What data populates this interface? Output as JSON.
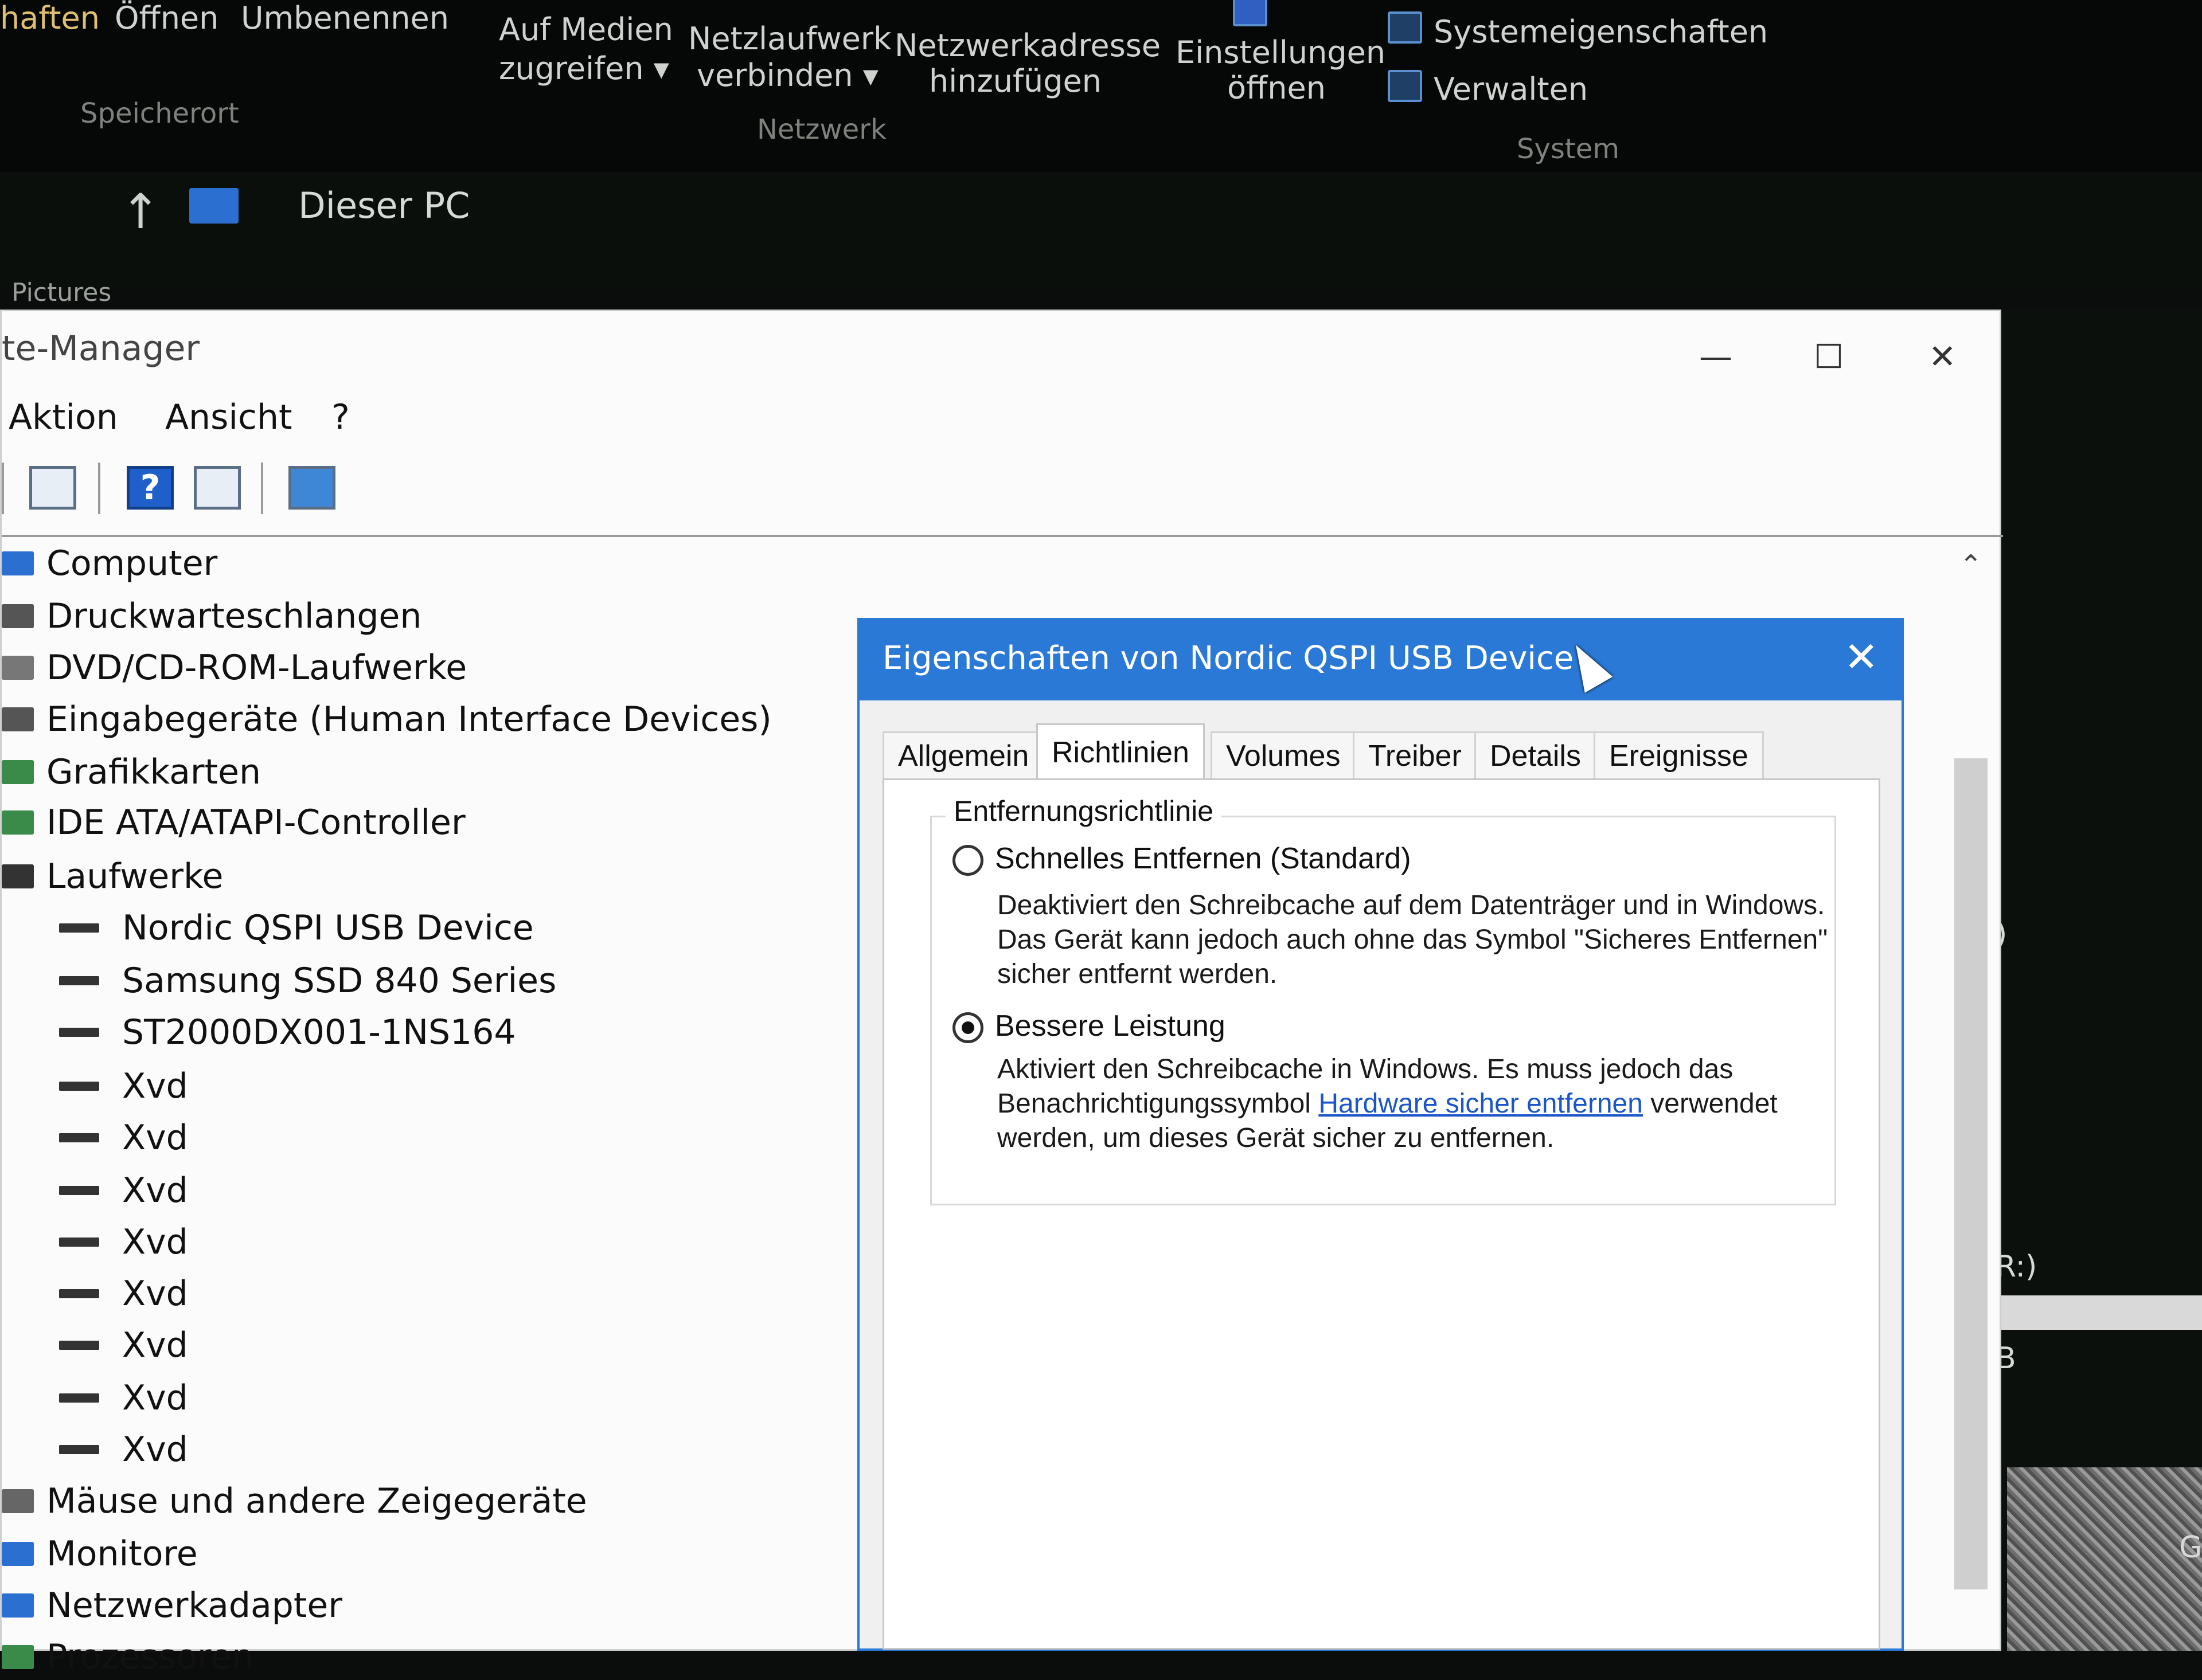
{
  "explorer": {
    "ribbon": {
      "left_items": [
        "haften",
        "Öffnen",
        "Umbenennen"
      ],
      "speicherort_label": "Speicherort",
      "media_btn": [
        "Auf Medien",
        "zugreifen ▾"
      ],
      "netdrive_btn": [
        "Netzlaufwerk",
        "verbinden ▾"
      ],
      "netaddr_btn": [
        "Netzwerkadresse",
        "hinzufügen"
      ],
      "netzwerk_label": "Netzwerk",
      "settings_btn": [
        "Einstellungen",
        "öffnen"
      ],
      "sys_props": "Systemeigenschaften",
      "manage": "Verwalten",
      "system_label": "System"
    },
    "address": {
      "path": "Dieser PC",
      "ghost_text": "Pictures"
    },
    "right_strip": {
      "text1": ")",
      "text2": "R:)",
      "text3": "B",
      "text4": "G"
    }
  },
  "device_manager": {
    "title": "te-Manager",
    "window_buttons": {
      "min": "—",
      "max": "☐",
      "close": "✕"
    },
    "menu": [
      "Aktion",
      "Ansicht",
      "?"
    ],
    "tree": [
      {
        "label": "Computer",
        "icon": "computer-icon",
        "level": 0,
        "color": "#2b6fd0"
      },
      {
        "label": "Druckwarteschlangen",
        "icon": "printer-icon",
        "level": 0,
        "color": "#555555"
      },
      {
        "label": "DVD/CD-ROM-Laufwerke",
        "icon": "dvd-icon",
        "level": 0,
        "color": "#777777"
      },
      {
        "label": "Eingabegeräte (Human Interface Devices)",
        "icon": "hid-icon",
        "level": 0,
        "color": "#555555"
      },
      {
        "label": "Grafikkarten",
        "icon": "graphics-card-icon",
        "level": 0,
        "color": "#3a8a4a"
      },
      {
        "label": "IDE ATA/ATAPI-Controller",
        "icon": "ide-controller-icon",
        "level": 0,
        "color": "#3a8a4a"
      },
      {
        "label": "Laufwerke",
        "icon": "drive-icon",
        "level": 0,
        "color": "#333333"
      },
      {
        "label": "Nordic QSPI USB Device",
        "icon": "drive-icon",
        "level": 1
      },
      {
        "label": "Samsung SSD 840 Series",
        "icon": "drive-icon",
        "level": 1
      },
      {
        "label": "ST2000DX001-1NS164",
        "icon": "drive-icon",
        "level": 1
      },
      {
        "label": "Xvd",
        "icon": "drive-icon",
        "level": 1
      },
      {
        "label": "Xvd",
        "icon": "drive-icon",
        "level": 1
      },
      {
        "label": "Xvd",
        "icon": "drive-icon",
        "level": 1
      },
      {
        "label": "Xvd",
        "icon": "drive-icon",
        "level": 1
      },
      {
        "label": "Xvd",
        "icon": "drive-icon",
        "level": 1
      },
      {
        "label": "Xvd",
        "icon": "drive-icon",
        "level": 1
      },
      {
        "label": "Xvd",
        "icon": "drive-icon",
        "level": 1
      },
      {
        "label": "Xvd",
        "icon": "drive-icon",
        "level": 1
      },
      {
        "label": "Mäuse und andere Zeigegeräte",
        "icon": "mouse-icon",
        "level": 0,
        "color": "#666666"
      },
      {
        "label": "Monitore",
        "icon": "monitor-icon",
        "level": 0,
        "color": "#2b6fd0"
      },
      {
        "label": "Netzwerkadapter",
        "icon": "network-adapter-icon",
        "level": 0,
        "color": "#2b6fd0"
      },
      {
        "label": "Prozessoren",
        "icon": "processor-icon",
        "level": 0,
        "color": "#3a8a4a"
      }
    ]
  },
  "dialog": {
    "title": "Eigenschaften von Nordic QSPI USB Device",
    "close": "✕",
    "tabs": [
      "Allgemein",
      "Richtlinien",
      "Volumes",
      "Treiber",
      "Details",
      "Ereignisse"
    ],
    "active_tab": "Richtlinien",
    "group_label": "Entfernungsrichtlinie",
    "option1": {
      "label": "Schnelles Entfernen (Standard)",
      "desc": "Deaktiviert den Schreibcache auf dem Datenträger und in Windows. Das Gerät kann jedoch auch ohne das Symbol \"Sicheres Entfernen\" sicher entfernt werden.",
      "selected": false
    },
    "option2": {
      "label": "Bessere Leistung",
      "desc_a": "Aktiviert den Schreibcache in Windows. Es muss jedoch das Benachrichtigungssymbol",
      "link": "Hardware sicher entfernen",
      "desc_b": "verwendet werden, um dieses Gerät sicher zu entfernen.",
      "selected": true
    }
  },
  "colors": {
    "accent": "#2b79d6",
    "link": "#1a55c9"
  }
}
